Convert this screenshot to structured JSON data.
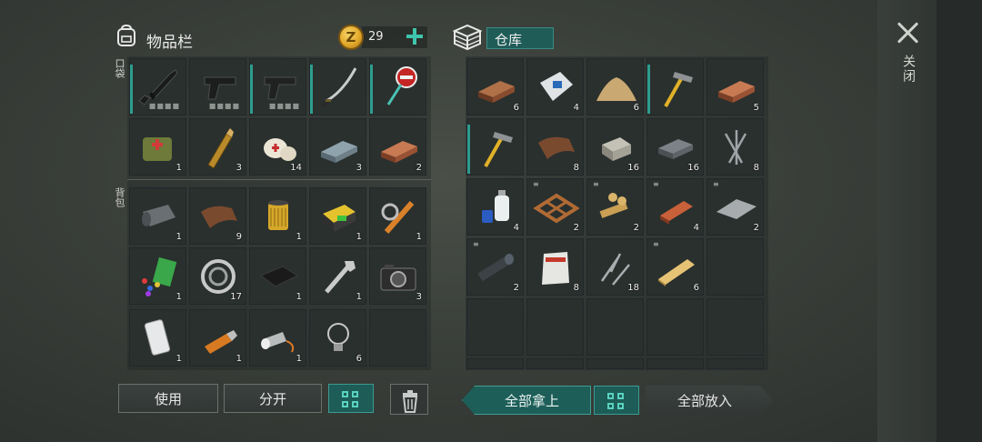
{
  "inventory": {
    "title": "物品栏",
    "coins": "29",
    "coin_symbol": "Z",
    "pocket_label": "口袋",
    "backpack_label": "背包",
    "pocket_items": [
      {
        "name": "assault-rifle",
        "count": "",
        "durability": "■■■■"
      },
      {
        "name": "pistol",
        "count": "",
        "durability": "■■■■"
      },
      {
        "name": "pistol-2",
        "count": "",
        "durability": "■■■■"
      },
      {
        "name": "katana",
        "count": "",
        "durability": ""
      },
      {
        "name": "stop-sign",
        "count": "",
        "durability": ""
      },
      {
        "name": "medkit-bag",
        "count": "1"
      },
      {
        "name": "bullets",
        "count": "3"
      },
      {
        "name": "bandage",
        "count": "14"
      },
      {
        "name": "iron-ingot",
        "count": "3"
      },
      {
        "name": "copper-ingot",
        "count": "2"
      }
    ],
    "backpack_items": [
      {
        "name": "tarp-roll",
        "count": "1"
      },
      {
        "name": "leather",
        "count": "9"
      },
      {
        "name": "oil-filter",
        "count": "1"
      },
      {
        "name": "battery",
        "count": "1"
      },
      {
        "name": "shock-absorber",
        "count": "1"
      },
      {
        "name": "scrap-plastic",
        "count": "1"
      },
      {
        "name": "bearing",
        "count": "17"
      },
      {
        "name": "black-cloth",
        "count": "1"
      },
      {
        "name": "wrench",
        "count": "1"
      },
      {
        "name": "camera",
        "count": "3"
      },
      {
        "name": "smartphone",
        "count": "1"
      },
      {
        "name": "usb-drive",
        "count": "1"
      },
      {
        "name": "flashlight",
        "count": "1"
      },
      {
        "name": "light-bulb",
        "count": "6"
      },
      {
        "name": "empty",
        "count": ""
      }
    ]
  },
  "storage": {
    "title": "仓库",
    "items": [
      {
        "name": "copper-ingot",
        "count": "6"
      },
      {
        "name": "cement-bag",
        "count": "4"
      },
      {
        "name": "sand-pile",
        "count": "6"
      },
      {
        "name": "hammer",
        "count": ""
      },
      {
        "name": "copper-ingot",
        "count": "5"
      },
      {
        "name": "hammer",
        "count": ""
      },
      {
        "name": "leather",
        "count": "8"
      },
      {
        "name": "stone-block",
        "count": "16"
      },
      {
        "name": "iron-ingot",
        "count": "16"
      },
      {
        "name": "nails",
        "count": "8"
      },
      {
        "name": "glue-bottles",
        "count": "4"
      },
      {
        "name": "wood-frame",
        "count": "2"
      },
      {
        "name": "wood-scraps",
        "count": "2"
      },
      {
        "name": "brick",
        "count": "4"
      },
      {
        "name": "metal-sheet",
        "count": "2"
      },
      {
        "name": "pipe",
        "count": "2"
      },
      {
        "name": "asbestos-bag",
        "count": "8"
      },
      {
        "name": "screws",
        "count": "18"
      },
      {
        "name": "wood-plank",
        "count": "6"
      }
    ]
  },
  "buttons": {
    "use": "使用",
    "split": "分开",
    "take_all": "全部拿上",
    "put_all": "全部放入",
    "close": "关闭"
  }
}
